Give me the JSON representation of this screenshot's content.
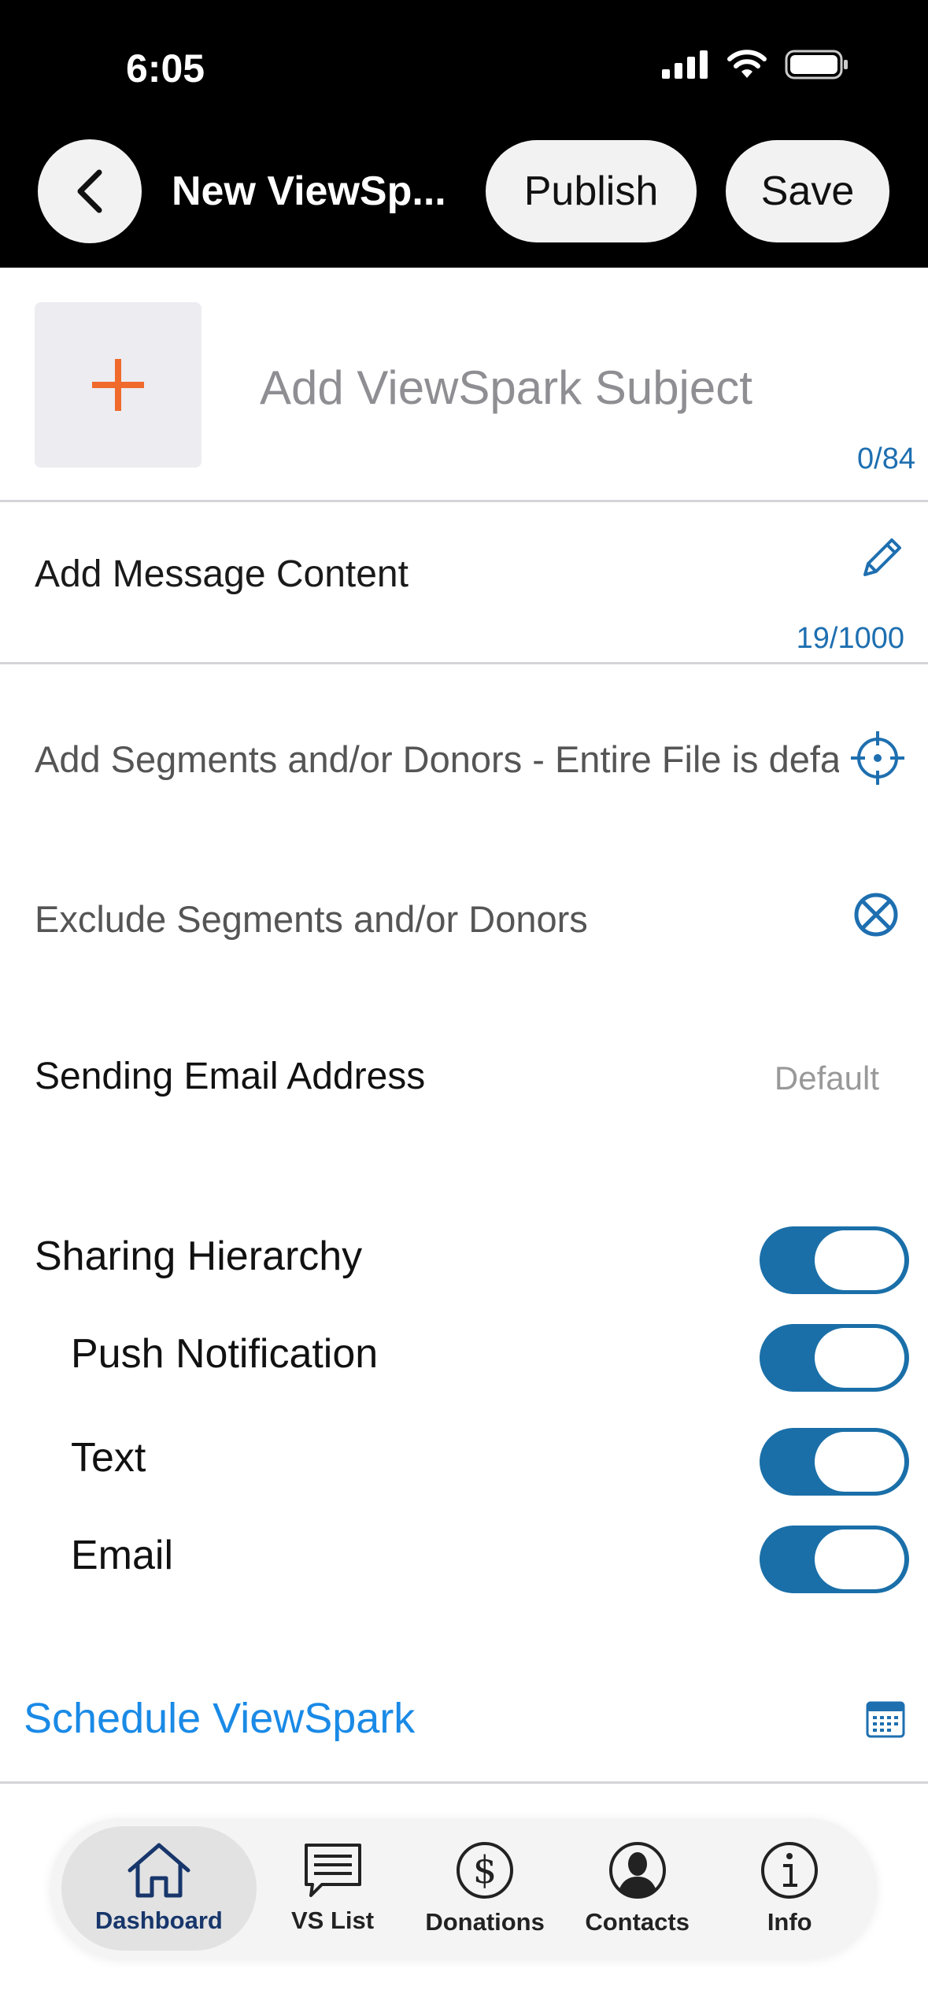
{
  "status_bar": {
    "time": "6:05"
  },
  "nav": {
    "title": "New ViewSp...",
    "publish_label": "Publish",
    "save_label": "Save"
  },
  "subject": {
    "placeholder": "Add ViewSpark Subject",
    "count": "0/84"
  },
  "message": {
    "label": "Add Message Content",
    "count": "19/1000"
  },
  "segments": {
    "add_label": "Add Segments and/or Donors - Entire File is defau",
    "exclude_label": "Exclude Segments and/or Donors"
  },
  "sending_email": {
    "label": "Sending Email Address",
    "value": "Default"
  },
  "toggles": [
    {
      "label": "Sharing Hierarchy",
      "on": true
    },
    {
      "label": "Push Notification",
      "on": true
    },
    {
      "label": "Text",
      "on": true
    },
    {
      "label": "Email",
      "on": true
    }
  ],
  "schedule": {
    "label": "Schedule ViewSpark"
  },
  "tab_bar": {
    "items": [
      {
        "label": "Dashboard",
        "icon": "home-icon",
        "active": true
      },
      {
        "label": "VS List",
        "icon": "message-list-icon",
        "active": false
      },
      {
        "label": "Donations",
        "icon": "dollar-icon",
        "active": false
      },
      {
        "label": "Contacts",
        "icon": "person-icon",
        "active": false
      },
      {
        "label": "Info",
        "icon": "info-icon",
        "active": false
      }
    ]
  },
  "colors": {
    "accent_blue": "#1a6fa8",
    "link_blue": "#1a8ae6",
    "plus_orange": "#ef6a2b"
  }
}
